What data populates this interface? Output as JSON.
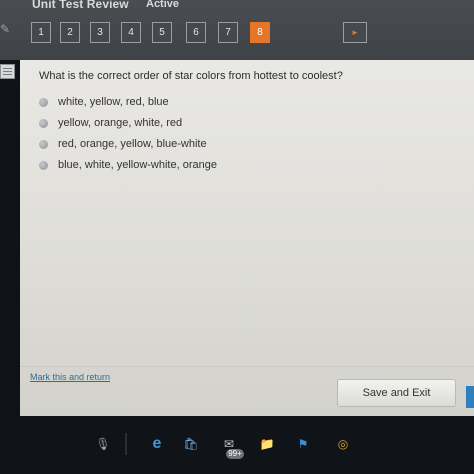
{
  "header": {
    "title": "Unit Test Review",
    "status": "Active",
    "question_numbers": [
      "1",
      "2",
      "3",
      "4",
      "5",
      "6",
      "7",
      "8"
    ],
    "active_question": "8",
    "next_icon": "chevron-right-icon"
  },
  "question": {
    "text": "What is the correct order of star colors from hottest to coolest?",
    "choices": [
      "white, yellow, red, blue",
      "yellow, orange, white, red",
      "red, orange, yellow, blue-white",
      "blue, white, yellow-white, orange"
    ]
  },
  "footer": {
    "mark_link": "Mark this and return",
    "save_exit": "Save and Exit"
  },
  "taskbar": {
    "icons": [
      "microphone-icon",
      "edge-icon",
      "store-icon",
      "mail-icon",
      "folder-icon",
      "flag-icon",
      "chrome-icon"
    ],
    "mail_badge": "99+"
  },
  "colors": {
    "accent": "#e4762a",
    "panel": "#e6e5e1",
    "topbar": "#45484c",
    "link": "#2e6f8e"
  }
}
